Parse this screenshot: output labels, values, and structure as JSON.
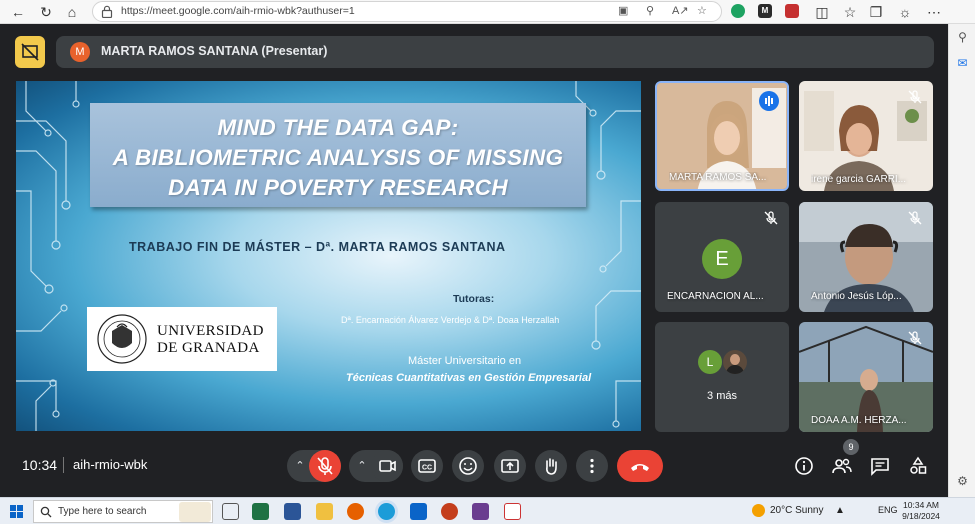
{
  "browser": {
    "url": "https://meet.google.com/aih-rmio-wbk?authuser=1"
  },
  "meet": {
    "presenter_label": "MARTA RAMOS SANTANA (Presentar)",
    "presenter_initial": "M",
    "slide": {
      "title_lines": [
        "MIND THE DATA GAP:",
        "A BIBLIOMETRIC ANALYSIS OF MISSING",
        "DATA IN POVERTY RESEARCH"
      ],
      "subtitle": "TRABAJO FIN DE MÁSTER – Dª. MARTA RAMOS SANTANA",
      "tutoras_label": "Tutoras:",
      "tutoras_names": "Dª. Encarnación Álvarez Verdejo & Dª. Doaa Herzallah",
      "master_line1": "Máster Universitario en",
      "master_line2": "Técnicas Cuantitativas en Gestión Empresarial",
      "university_line1": "UNIVERSIDAD",
      "university_line2": "DE GRANADA"
    },
    "participants": [
      {
        "name": "MARTA RAMOS SA...",
        "speaking": true
      },
      {
        "name": "irene garcia GARRI...",
        "muted": true
      },
      {
        "name": "ENCARNACION AL...",
        "initial": "E",
        "muted": true
      },
      {
        "name": "Antonio Jesús Lóp...",
        "muted": true
      },
      {
        "more_label": "3 más",
        "initial": "L"
      },
      {
        "name": "DOAA A.M. HERZA...",
        "muted": true
      }
    ],
    "clock": "10:34",
    "meeting_code": "aih-rmio-wbk",
    "participants_count": "9"
  },
  "taskbar": {
    "search_placeholder": "Type here to search",
    "weather": "20°C  Sunny",
    "lang": "ENG",
    "time": "10:34 AM",
    "date": "9/18/2024"
  },
  "colors": {
    "accent": "#8ab4f8",
    "danger": "#ea4335",
    "meet_bg": "#202124",
    "tile_bg": "#3c4043"
  }
}
